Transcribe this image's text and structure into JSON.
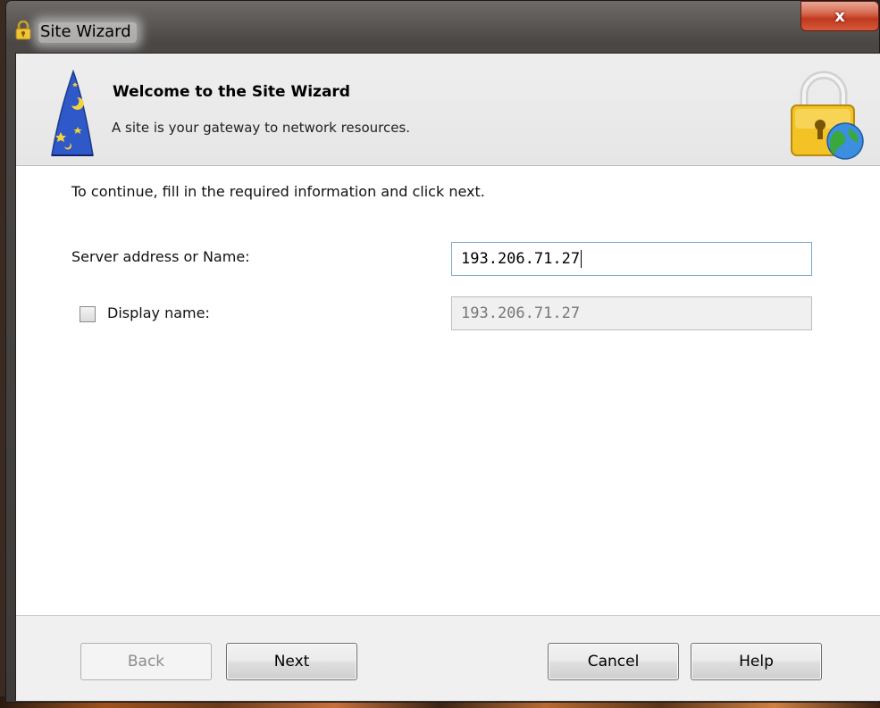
{
  "window": {
    "title": "Site Wizard",
    "close_label": "x"
  },
  "header": {
    "title": "Welcome to the Site Wizard",
    "subtitle": "A site is your gateway to network resources."
  },
  "form": {
    "instructions": "To continue, fill in the required information and click next.",
    "server_label": "Server address or Name:",
    "server_value": "193.206.71.27",
    "display_label": "Display name:",
    "display_checked": false,
    "display_value": "193.206.71.27"
  },
  "buttons": {
    "back": "Back",
    "next": "Next",
    "cancel": "Cancel",
    "help": "Help"
  },
  "icons": {
    "title": "lock-icon",
    "wizard": "wizard-hat-icon",
    "banner": "lock-globe-icon"
  },
  "colors": {
    "close_button": "#c0391f",
    "input_focus_border": "#7aa7d6"
  }
}
